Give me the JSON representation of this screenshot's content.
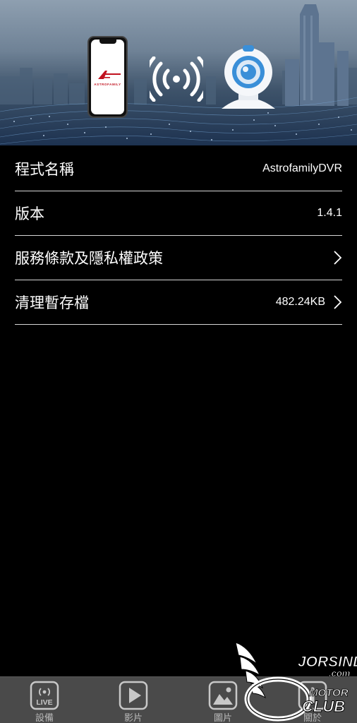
{
  "banner": {
    "phone_logo_text": "ASTROFAMILY",
    "icons": [
      "smartphone-icon",
      "wifi-signal-icon",
      "webcam-icon"
    ]
  },
  "settings": {
    "rows": [
      {
        "label": "程式名稱",
        "value": "AstrofamilyDVR",
        "chevron": false
      },
      {
        "label": "版本",
        "value": "1.4.1",
        "chevron": false
      },
      {
        "label": "服務條款及隱私權政策",
        "value": "",
        "chevron": true
      },
      {
        "label": "清理暫存檔",
        "value": "482.24KB",
        "chevron": true
      }
    ]
  },
  "tabbar": {
    "tabs": [
      {
        "label": "設備",
        "icon": "live-icon",
        "icon_text": "LIVE"
      },
      {
        "label": "影片",
        "icon": "play-icon"
      },
      {
        "label": "圖片",
        "icon": "image-icon"
      },
      {
        "label": "關於",
        "icon": "info-icon"
      }
    ]
  },
  "watermark": {
    "line1": "JORSINDO",
    "line2": ".com",
    "line3": "MOTOR",
    "line4": "CLUB"
  },
  "colors": {
    "background": "#000000",
    "divider": "#d6d6d6",
    "tabbar_bg": "#4a4a4a",
    "tab_label": "#b9b9b9",
    "camera_blue": "#3a8fd8",
    "logo_red": "#c1121f"
  }
}
